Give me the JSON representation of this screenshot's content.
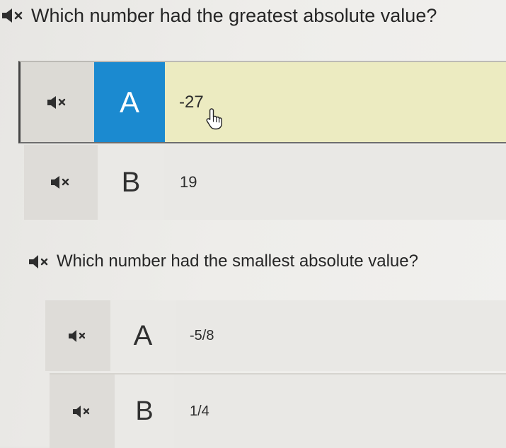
{
  "questions": [
    {
      "text": "Which number had the greatest absolute value?",
      "speaker_icon": "speaker-muted-icon",
      "options": [
        {
          "letter": "A",
          "value": "-27",
          "selected": true,
          "speaker_icon": "speaker-muted-icon"
        },
        {
          "letter": "B",
          "value": "19",
          "selected": false,
          "speaker_icon": "speaker-muted-icon"
        }
      ]
    },
    {
      "text": "Which number had the smallest absolute value?",
      "speaker_icon": "speaker-muted-icon",
      "options": [
        {
          "letter": "A",
          "value": "-5/8",
          "selected": false,
          "speaker_icon": "speaker-muted-icon"
        },
        {
          "letter": "B",
          "value": "1/4",
          "selected": false,
          "speaker_icon": "speaker-muted-icon"
        }
      ]
    }
  ],
  "colors": {
    "selected_letter_bg": "#1b8ad0",
    "selected_row_bg": "#ecebc1",
    "option_bg": "#e9e8e5",
    "audio_cell_bg": "#dedcd8"
  },
  "cursor_icon": "hand-pointer-icon"
}
